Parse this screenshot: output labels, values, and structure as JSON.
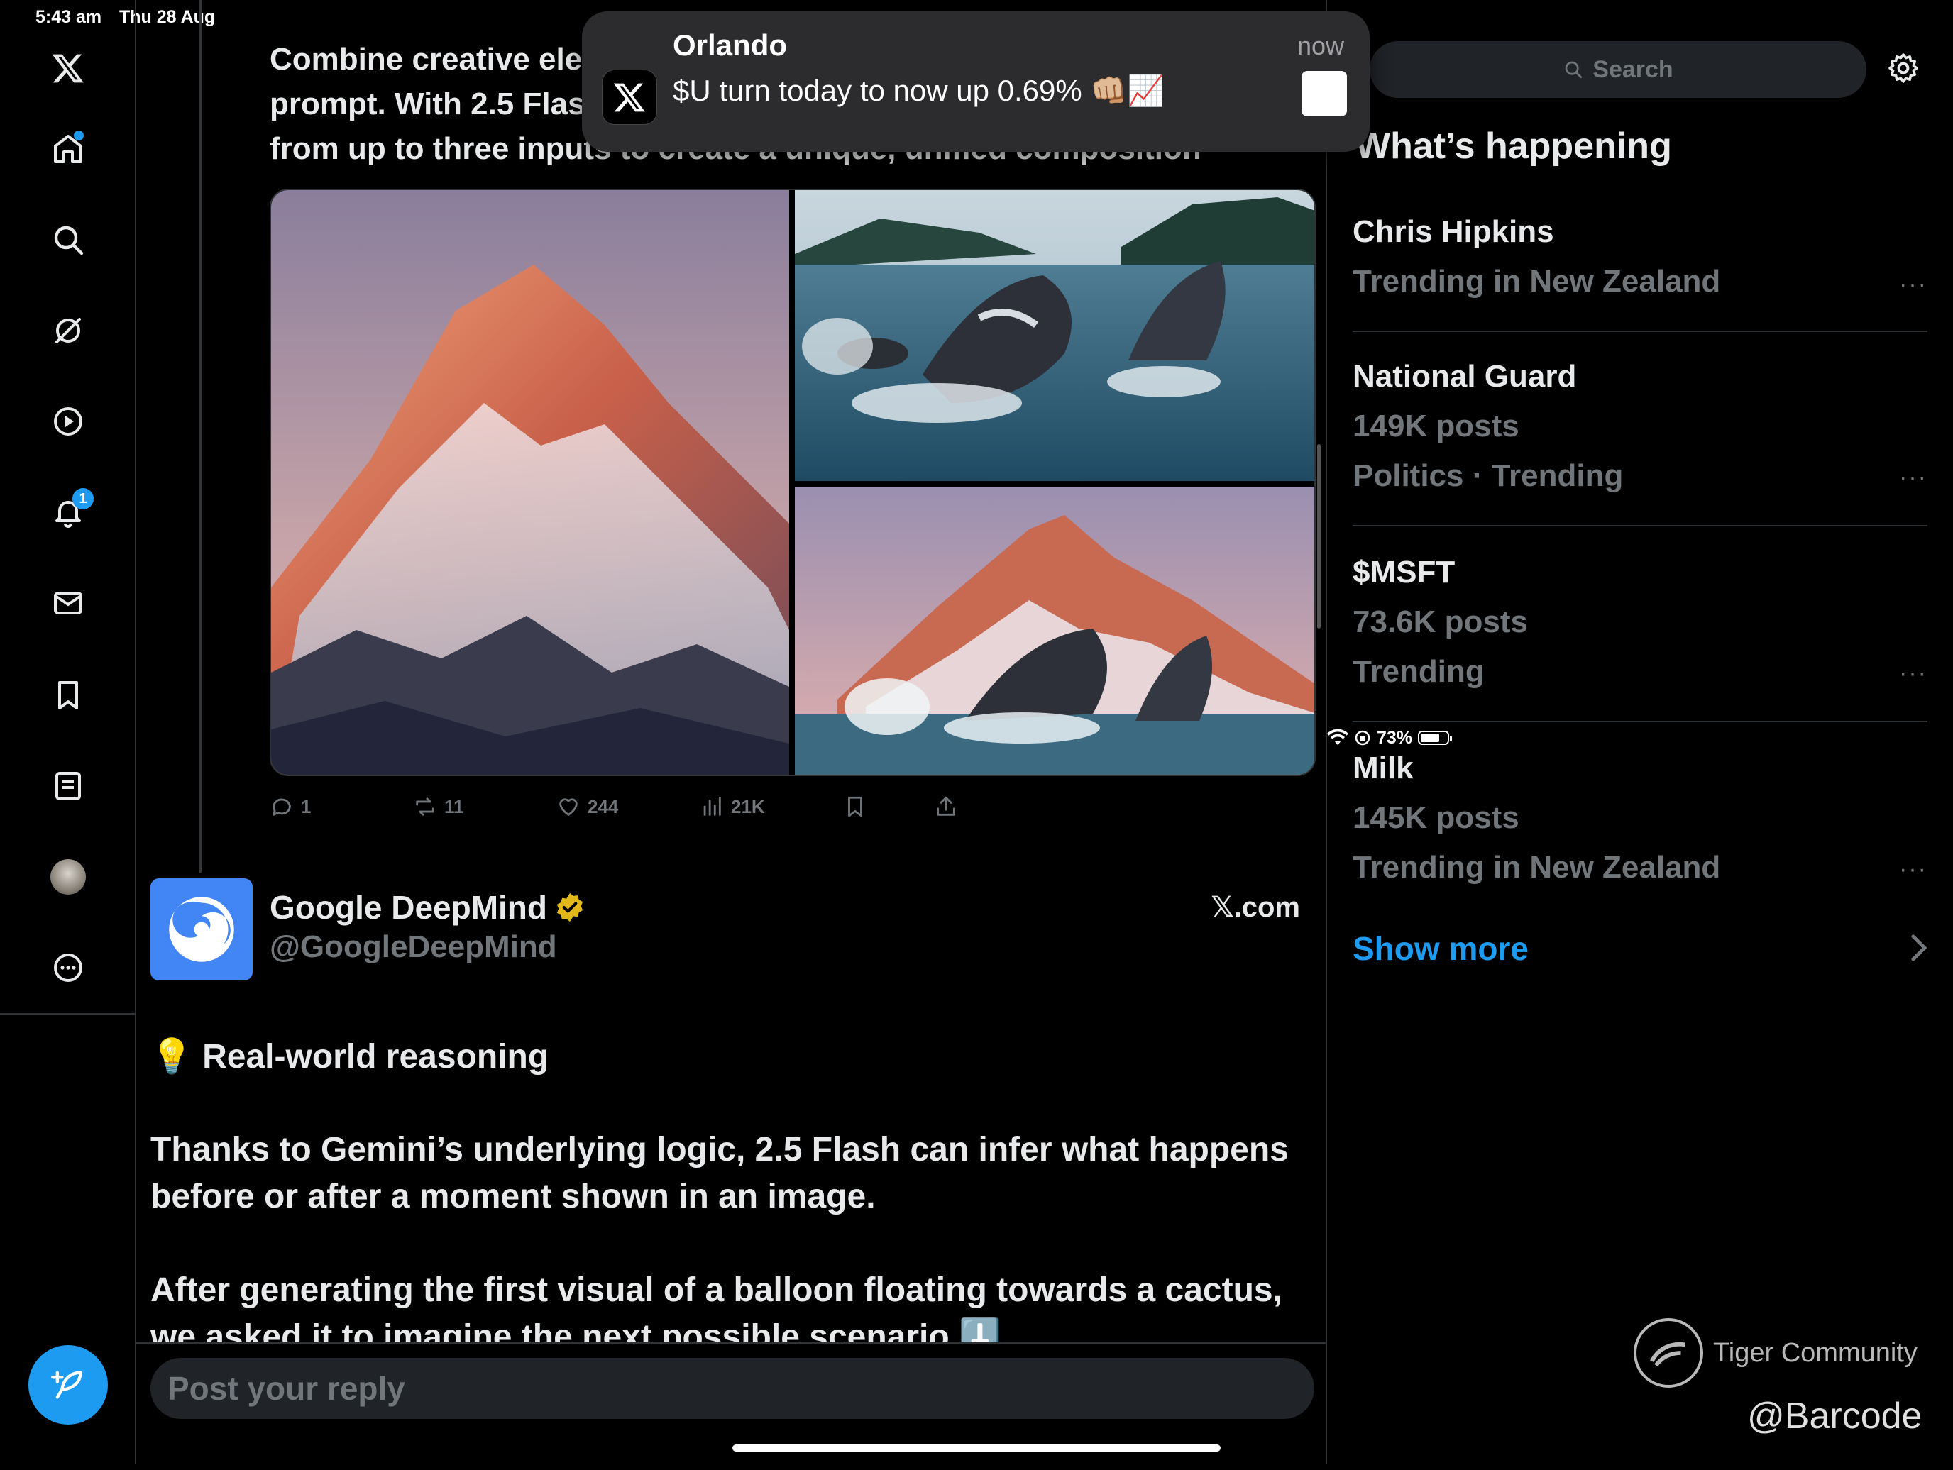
{
  "status_bar": {
    "time": "5:43 am",
    "date": "Thu 28 Aug",
    "battery": "73%",
    "battery_level": 0.73
  },
  "left_nav": {
    "notifications_count": "1",
    "items": [
      "x-logo",
      "home",
      "explore",
      "grok",
      "video",
      "notifications",
      "messages",
      "bookmarks",
      "lists",
      "profile",
      "more"
    ]
  },
  "notification": {
    "title": "Orlando",
    "message": "$U turn today to now up 0.69% 👊🏼📈",
    "time": "now"
  },
  "tweet": {
    "text_lines": [
      "Combine creative ele",
      "prompt. With 2.5 Flas",
      "from up to three inputs to create a unique, unified composition"
    ],
    "stats": {
      "replies": "1",
      "reposts": "11",
      "likes": "244",
      "views": "21K"
    }
  },
  "card": {
    "name": "Google DeepMind",
    "handle": "@GoogleDeepMind",
    "site": "𝕏.com",
    "heading": "💡 Real-world reasoning",
    "body": "Thanks to Gemini’s underlying logic, 2.5 Flash can infer what happens before or after a moment shown in an image.\n\nAfter generating the first visual of a balloon floating towards a cactus, we asked it to imagine the next possible scenario ⬇️"
  },
  "reply": {
    "placeholder": "Post your reply"
  },
  "sidebar": {
    "search_placeholder": "Search",
    "whats_happening": "What’s happening",
    "trends": [
      {
        "name": "Chris Hipkins",
        "lines": [
          "Trending in New Zealand"
        ]
      },
      {
        "name": "National Guard",
        "lines": [
          "149K posts",
          "Politics · Trending"
        ]
      },
      {
        "name": "$MSFT",
        "lines": [
          "73.6K posts",
          "Trending"
        ]
      },
      {
        "name": "Milk",
        "lines": [
          "145K posts",
          "Trending in New Zealand"
        ]
      }
    ],
    "more_glyph": "···",
    "show_more": "Show more"
  },
  "watermark": {
    "brand": "Tiger Community",
    "user": "@Barcode"
  },
  "colors": {
    "accent": "#1d9bf0",
    "background": "#000000",
    "muted": "#71767b",
    "border": "#2f3336",
    "verified": "#e2b719"
  }
}
